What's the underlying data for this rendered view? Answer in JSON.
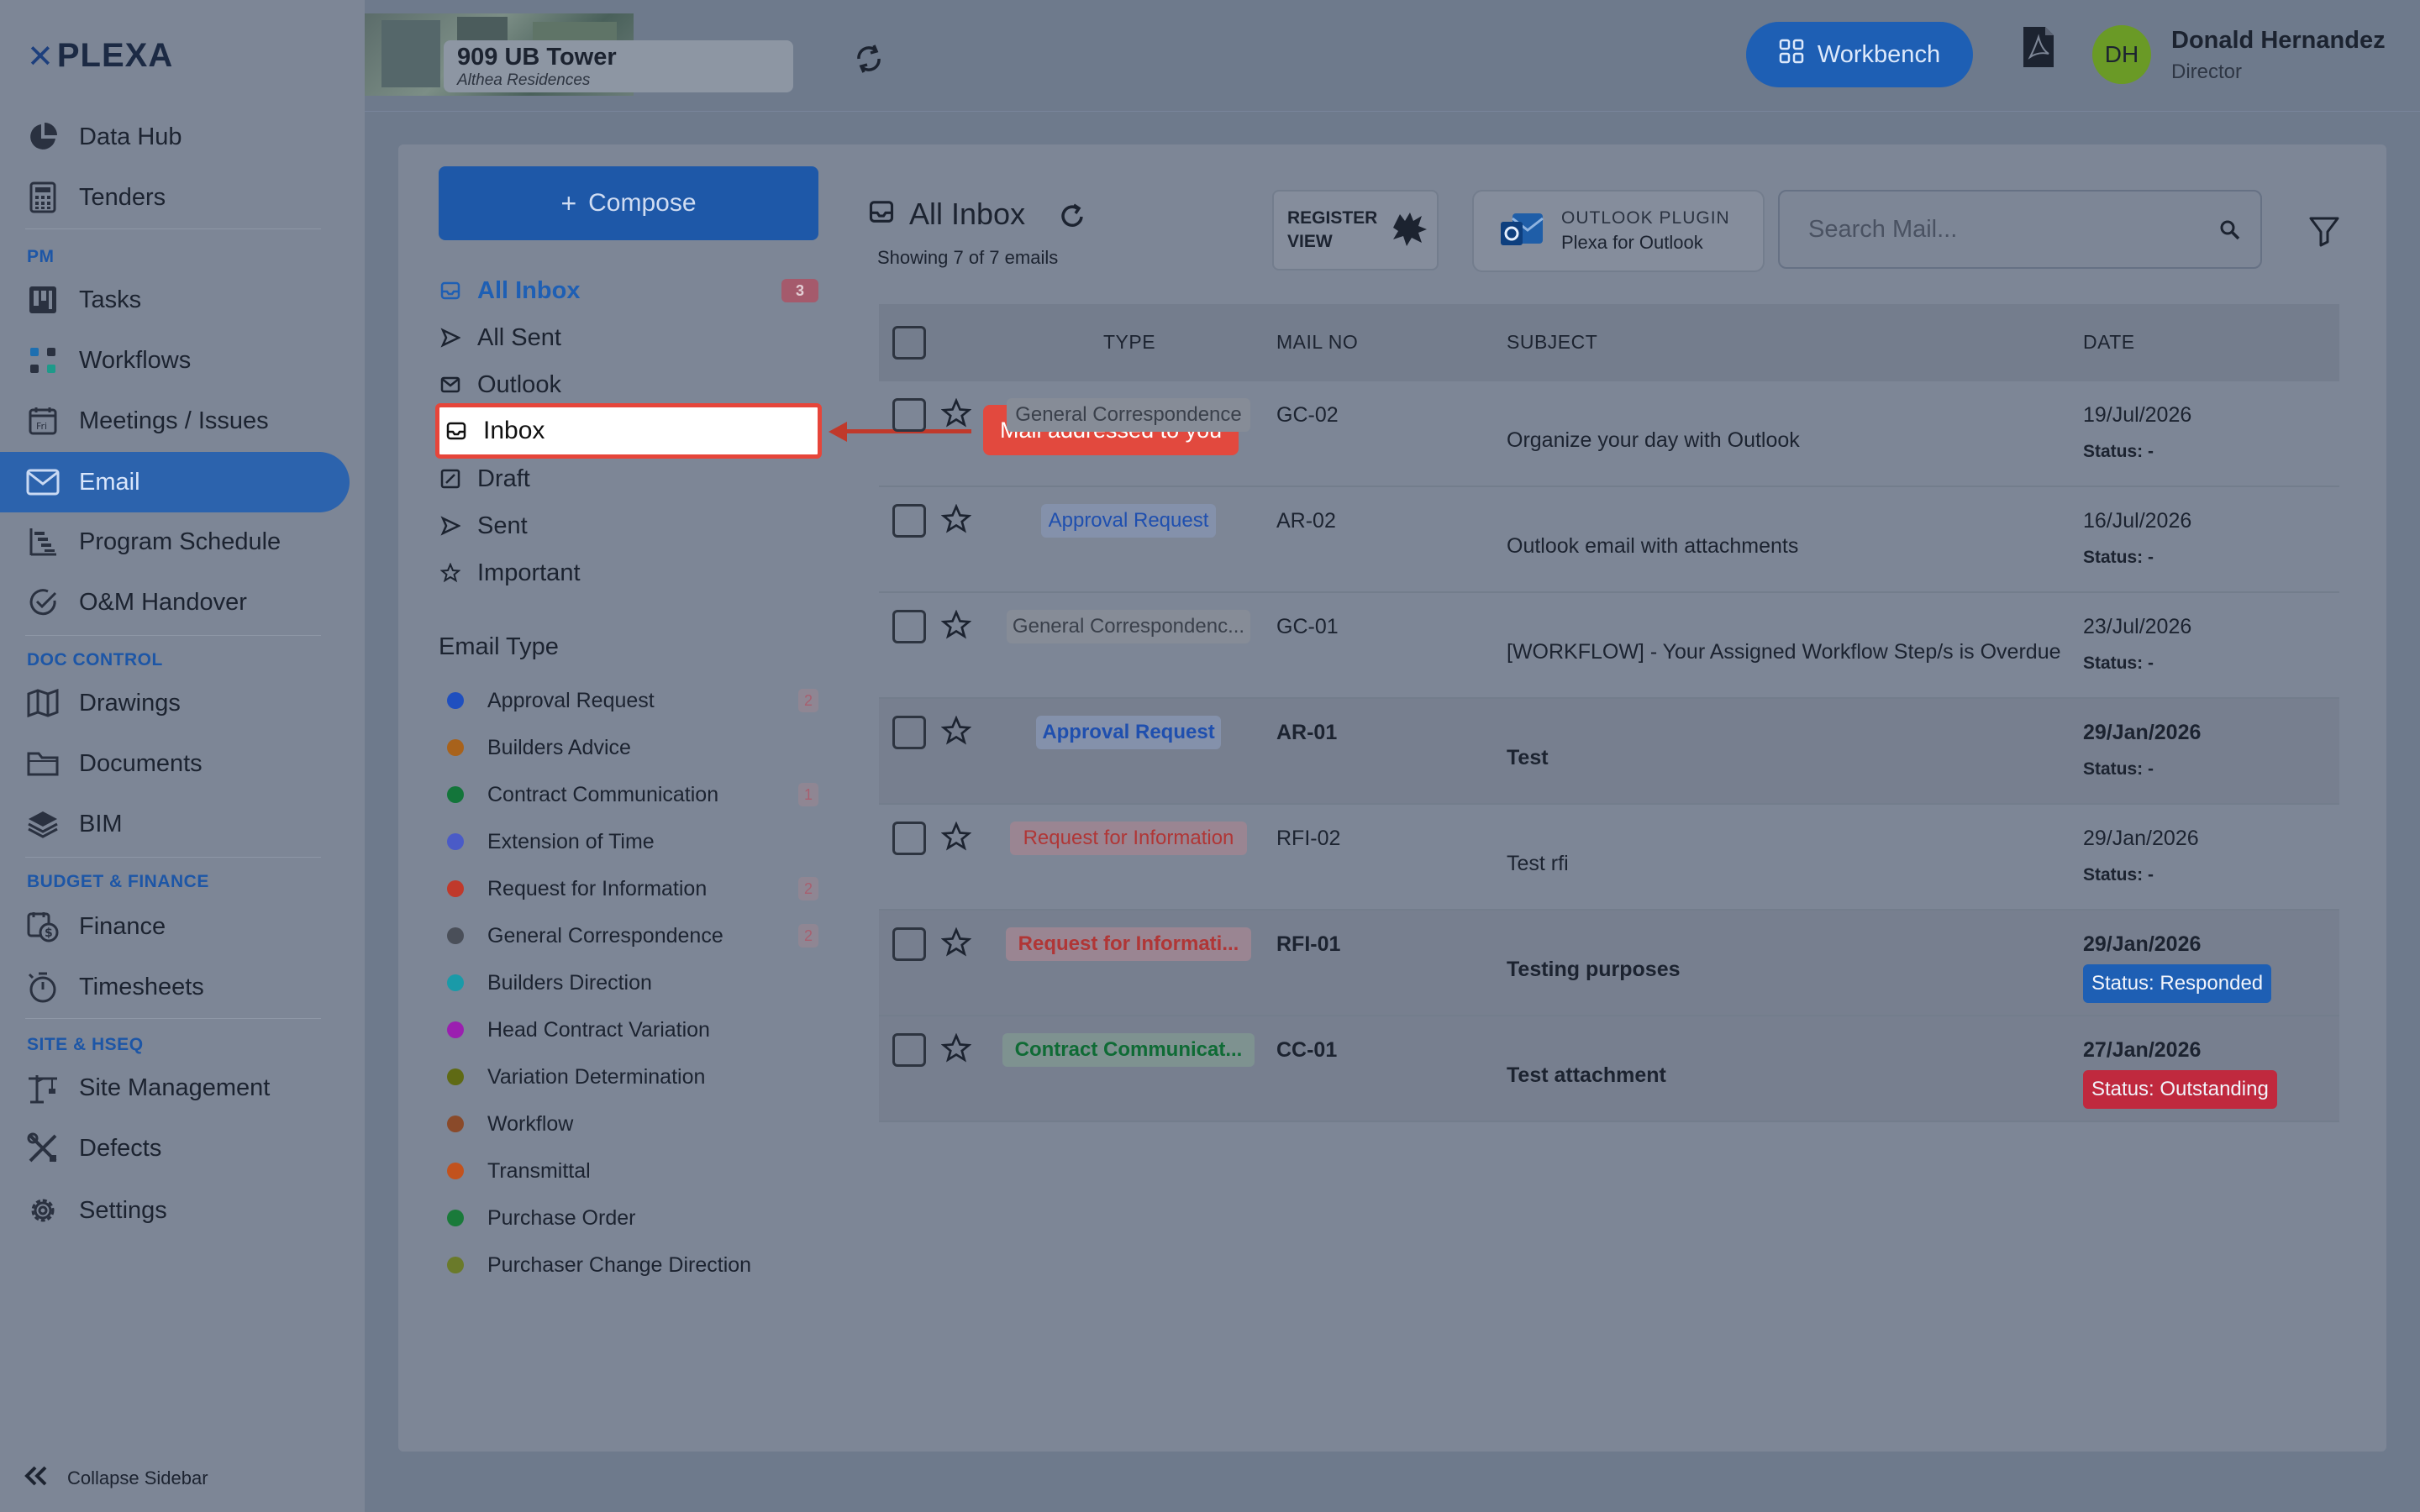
{
  "app": {
    "logo_mark": "✕",
    "logo_text": "PLEXA"
  },
  "sidebar": {
    "items": [
      {
        "label": "Data Hub",
        "icon": "pie-chart-icon"
      },
      {
        "label": "Tenders",
        "icon": "calculator-icon"
      },
      {
        "label": "Tasks",
        "icon": "kanban-icon"
      },
      {
        "label": "Workflows",
        "icon": "workflow-icon"
      },
      {
        "label": "Meetings / Issues",
        "icon": "calendar-icon"
      },
      {
        "label": "Email",
        "icon": "envelope-icon"
      },
      {
        "label": "Program Schedule",
        "icon": "gantt-icon"
      },
      {
        "label": "O&M Handover",
        "icon": "check-circle-icon"
      },
      {
        "label": "Drawings",
        "icon": "map-icon"
      },
      {
        "label": "Documents",
        "icon": "folder-icon"
      },
      {
        "label": "BIM",
        "icon": "layers-icon"
      },
      {
        "label": "Finance",
        "icon": "dollar-calendar-icon"
      },
      {
        "label": "Timesheets",
        "icon": "stopwatch-icon"
      },
      {
        "label": "Site Management",
        "icon": "crane-icon"
      },
      {
        "label": "Defects",
        "icon": "tools-icon"
      },
      {
        "label": "Settings",
        "icon": "gear-icon"
      }
    ],
    "sections": {
      "pm": "PM",
      "doc_control": "DOC CONTROL",
      "budget": "BUDGET & FINANCE",
      "site": "SITE & HSEQ"
    },
    "collapse_label": "Collapse Sidebar"
  },
  "project": {
    "name": "909 UB Tower",
    "subtitle": "Althea Residences"
  },
  "header": {
    "workbench_label": "Workbench",
    "user": {
      "initials": "DH",
      "name": "Donald Hernandez",
      "role": "Director",
      "avatar_color": "#6a9a26"
    }
  },
  "mail": {
    "compose_label": "Compose",
    "folders": [
      {
        "label": "All Inbox",
        "badge": "3",
        "icon": "inbox-icon"
      },
      {
        "label": "All Sent",
        "badge": "",
        "icon": "send-icon"
      },
      {
        "label": "Outlook",
        "badge": "",
        "icon": "envelope-icon"
      },
      {
        "label": "Inbox",
        "badge": "",
        "icon": "inbox-icon"
      },
      {
        "label": "Draft",
        "badge": "",
        "icon": "draft-icon"
      },
      {
        "label": "Sent",
        "badge": "",
        "icon": "send-icon"
      },
      {
        "label": "Important",
        "badge": "",
        "icon": "star-icon"
      }
    ],
    "tooltip": "Mail addressed to you",
    "email_type_title": "Email Type",
    "email_types": [
      {
        "label": "Approval Request",
        "color": "#1f4fbf",
        "count": "2"
      },
      {
        "label": "Builders Advice",
        "color": "#a8621b",
        "count": ""
      },
      {
        "label": "Contract Communication",
        "color": "#13753a",
        "count": "1"
      },
      {
        "label": "Extension of Time",
        "color": "#4a5bc7",
        "count": ""
      },
      {
        "label": "Request for Information",
        "color": "#c0392b",
        "count": "2"
      },
      {
        "label": "General Correspondence",
        "color": "#4a4f59",
        "count": "2"
      },
      {
        "label": "Builders Direction",
        "color": "#1a9aa8",
        "count": ""
      },
      {
        "label": "Head Contract Variation",
        "color": "#9b1fb0",
        "count": ""
      },
      {
        "label": "Variation Determination",
        "color": "#5f6a14",
        "count": ""
      },
      {
        "label": "Workflow",
        "color": "#8a4a2a",
        "count": ""
      },
      {
        "label": "Transmittal",
        "color": "#c2521d",
        "count": ""
      },
      {
        "label": "Purchase Order",
        "color": "#1a7a3a",
        "count": ""
      },
      {
        "label": "Purchaser Change Direction",
        "color": "#6a7a2a",
        "count": ""
      }
    ],
    "list": {
      "title": "All Inbox",
      "count_text": "Showing 7 of 7 emails",
      "register_view": "REGISTER VIEW",
      "outlook_plugin_title": "OUTLOOK PLUGIN",
      "outlook_plugin_sub": "Plexa for Outlook",
      "search_placeholder": "Search Mail...",
      "columns": {
        "type": "TYPE",
        "mail_no": "MAIL NO",
        "subject": "SUBJECT",
        "date": "DATE"
      },
      "rows": [
        {
          "type": "General Correspondence",
          "type_color": "gray",
          "mail_no": "GC-02",
          "subject": "Organize your day with Outlook",
          "date": "19/Jul/2026",
          "status": "Status: -",
          "unread": false
        },
        {
          "type": "Approval Request",
          "type_color": "blue",
          "mail_no": "AR-02",
          "subject": "Outlook email with attachments",
          "date": "16/Jul/2026",
          "status": "Status: -",
          "unread": false
        },
        {
          "type": "General Correspondenc...",
          "type_color": "gray",
          "mail_no": "GC-01",
          "subject": "[WORKFLOW] - Your Assigned Workflow Step/s is Overdue",
          "date": "23/Jul/2026",
          "status": "Status: -",
          "unread": false
        },
        {
          "type": "Approval Request",
          "type_color": "blue",
          "mail_no": "AR-01",
          "subject": "Test",
          "date": "29/Jan/2026",
          "status": "Status: -",
          "unread": true
        },
        {
          "type": "Request for Information",
          "type_color": "red",
          "mail_no": "RFI-02",
          "subject": "Test rfi",
          "date": "29/Jan/2026",
          "status": "Status: -",
          "unread": false
        },
        {
          "type": "Request for Informati...",
          "type_color": "red",
          "mail_no": "RFI-01",
          "subject": "Testing purposes",
          "date": "29/Jan/2026",
          "status": "Status: Responded",
          "status_color": "#1e5fb4",
          "unread": true
        },
        {
          "type": "Contract Communicat...",
          "type_color": "green",
          "mail_no": "CC-01",
          "subject": "Test attachment",
          "date": "27/Jan/2026",
          "status": "Status: Outstanding",
          "status_color": "#c0293e",
          "unread": true
        }
      ]
    }
  }
}
